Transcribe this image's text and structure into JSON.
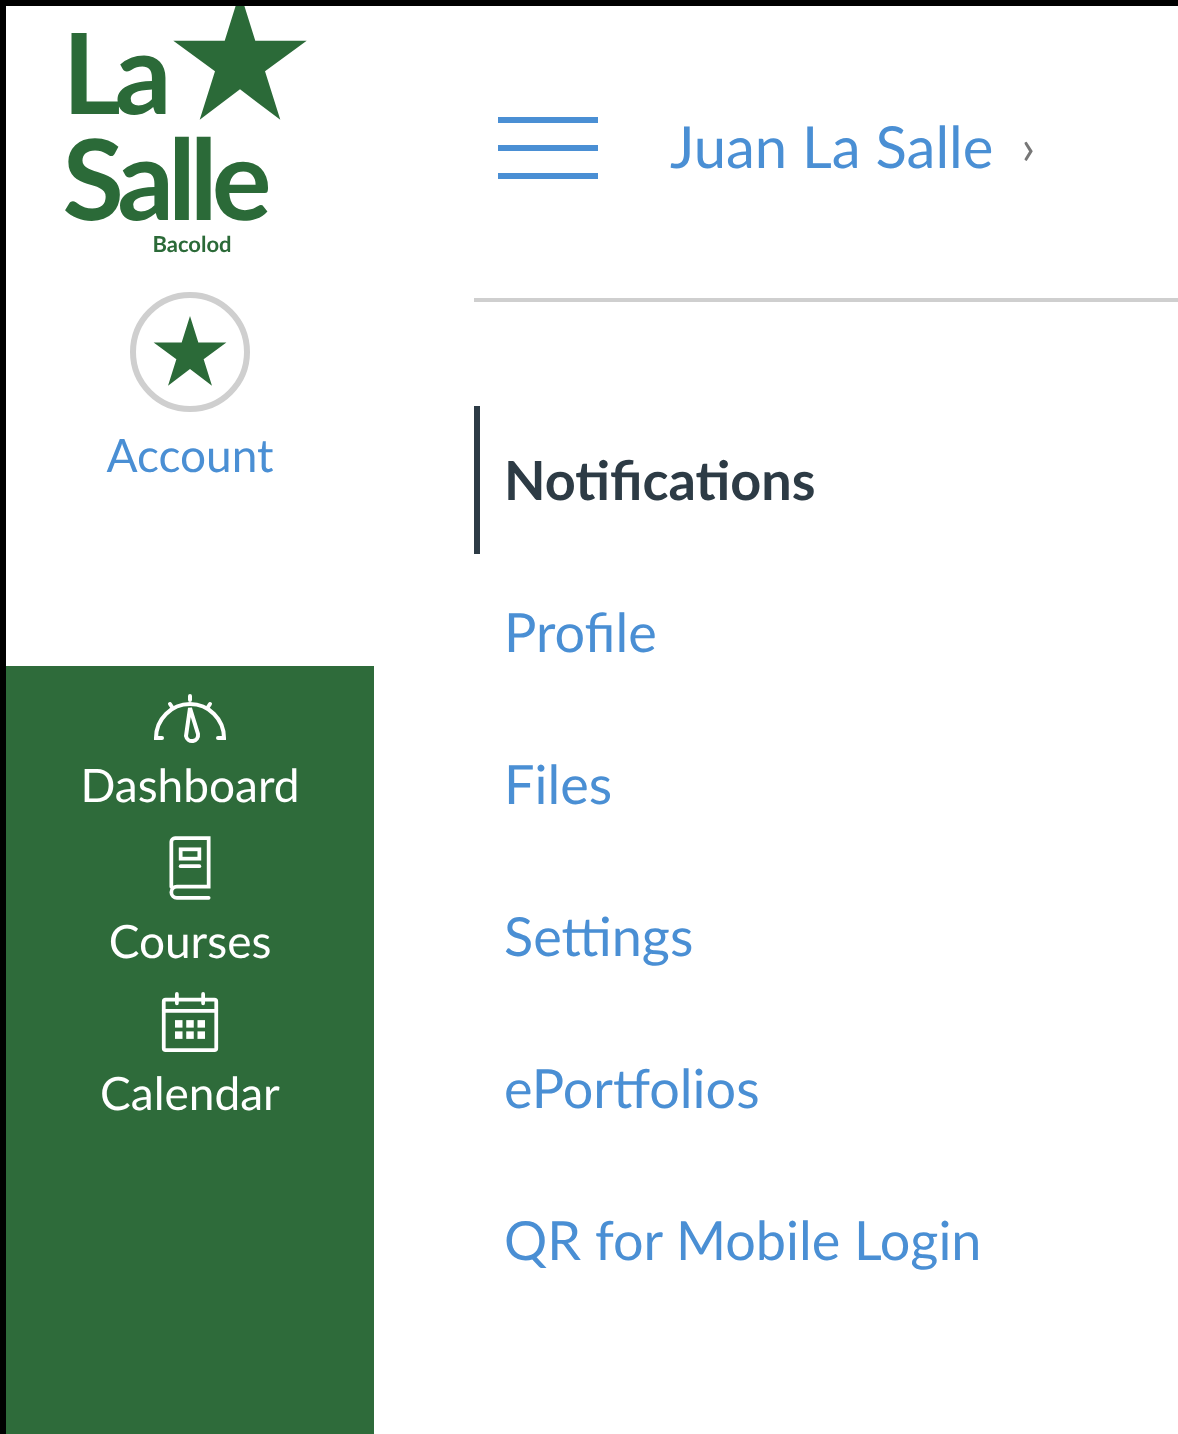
{
  "logo": {
    "line_1": "La",
    "line_2": "Salle",
    "line_3": "Bacolod"
  },
  "account": {
    "label": "Account"
  },
  "global_nav": [
    {
      "kind": "dashboard",
      "label": "Dashboard"
    },
    {
      "kind": "courses",
      "label": "Courses"
    },
    {
      "kind": "calendar",
      "label": "Calendar"
    }
  ],
  "header": {
    "title": "Juan La Salle",
    "chevron": "›"
  },
  "menu": [
    {
      "label": "Notifications",
      "selected": true
    },
    {
      "label": "Profile",
      "selected": false
    },
    {
      "label": "Files",
      "selected": false
    },
    {
      "label": "Settings",
      "selected": false
    },
    {
      "label": "ePortfolios",
      "selected": false
    },
    {
      "label": "QR for Mobile Login",
      "selected": false
    }
  ]
}
